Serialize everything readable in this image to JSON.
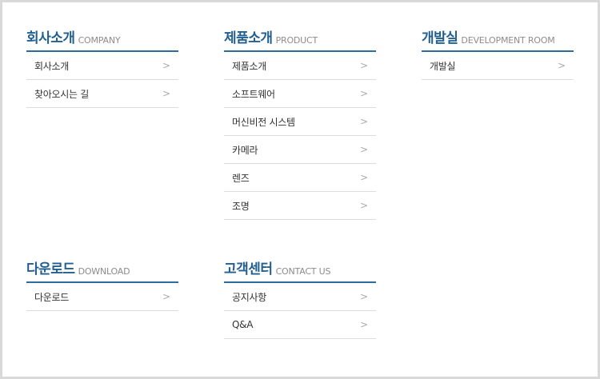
{
  "sections": [
    {
      "title": "회사소개",
      "subtitle": "COMPANY",
      "items": [
        "회사소개",
        "찾아오시는 길"
      ]
    },
    {
      "title": "제품소개",
      "subtitle": "PRODUCT",
      "items": [
        "제품소개",
        "소프트웨어",
        "머신비전 시스템",
        "카메라",
        "렌즈",
        "조명"
      ]
    },
    {
      "title": "개발실",
      "subtitle": "DEVELOPMENT ROOM",
      "items": [
        "개발실"
      ]
    },
    {
      "title": "다운로드",
      "subtitle": "DOWNLOAD",
      "items": [
        "다운로드"
      ]
    },
    {
      "title": "고객센터",
      "subtitle": "CONTACT US",
      "items": [
        "공지사항",
        "Q&A"
      ]
    }
  ],
  "icons": {
    "item_arrow": "chevron-right-icon"
  },
  "colors": {
    "accent": "#2c6d9e",
    "title": "#215f91",
    "divider": "#dcdcdc"
  }
}
